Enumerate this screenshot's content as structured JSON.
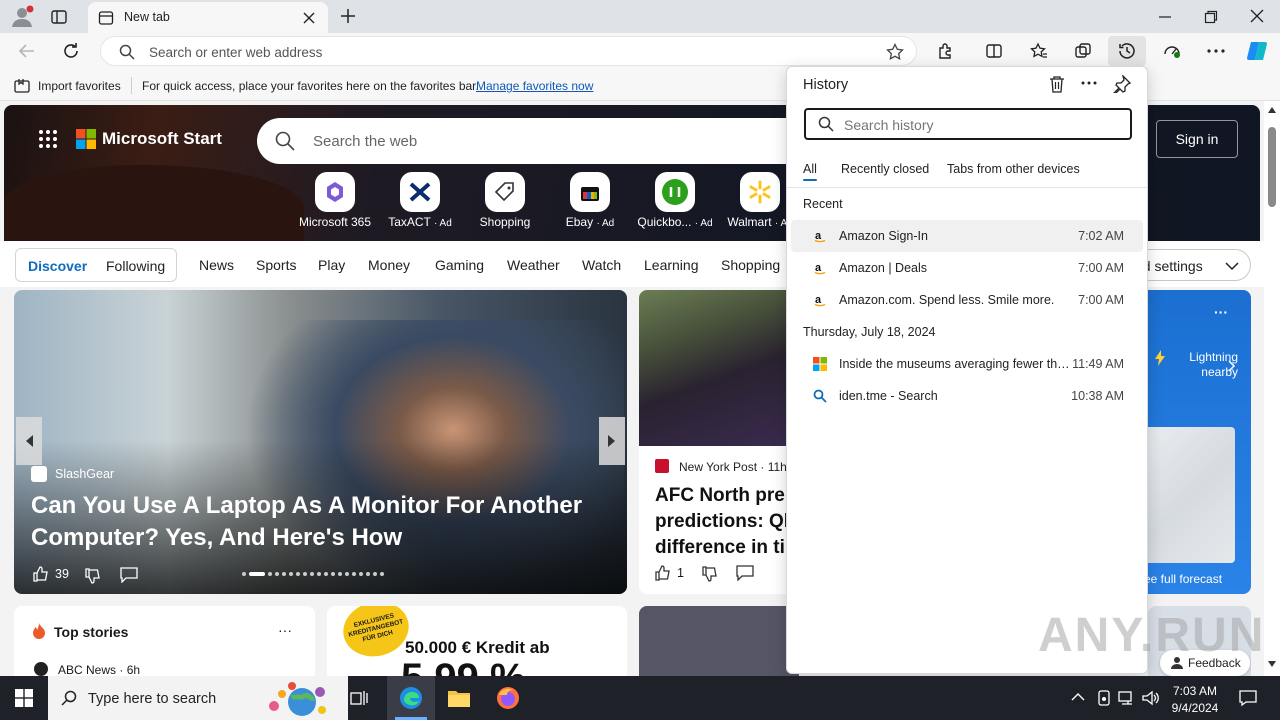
{
  "browser": {
    "tab_title": "New tab",
    "address_placeholder": "Search or enter web address"
  },
  "favorites_bar": {
    "import_label": "Import favorites",
    "hint": "For quick access, place your favorites here on the favorites bar.",
    "manage_link": "Manage favorites now"
  },
  "msstart": {
    "brand": "Microsoft Start",
    "search_placeholder": "Search the web",
    "sign_in": "Sign in",
    "tiles": [
      {
        "label": "Microsoft 365",
        "ad": ""
      },
      {
        "label": "TaxACT",
        "ad": "· Ad"
      },
      {
        "label": "Shopping",
        "ad": ""
      },
      {
        "label": "Ebay",
        "ad": "· Ad"
      },
      {
        "label": "Quickbo...",
        "ad": "· Ad"
      },
      {
        "label": "Walmart",
        "ad": "· Ad"
      }
    ],
    "nav": [
      "Discover",
      "Following",
      "News",
      "Sports",
      "Play",
      "Money",
      "Gaming",
      "Weather",
      "Watch",
      "Learning",
      "Shopping"
    ],
    "feed_settings": "ed settings",
    "main_story": {
      "source": "SlashGear",
      "headline": "Can You Use A Laptop As A Monitor For Another Computer? Yes, And Here's How",
      "likes": "39"
    },
    "second_story": {
      "source": "New York Post",
      "age": "· 11h",
      "headline": "AFC North pre predictions: Ql difference in ti",
      "likes": "1"
    },
    "weather": {
      "alert": "Lightning nearby",
      "forecast": "ee full forecast",
      "more": "···"
    },
    "top_stories": {
      "title": "Top stories",
      "more": "···",
      "first_source": "ABC News",
      "first_age": "· 6h"
    },
    "ad_card": {
      "badge": "EXKLUSIVES KREDITANGEBOT FÜR DICH",
      "headline": "50.000 € Kredit ab",
      "big": "5,99 %"
    },
    "feedback": "Feedback"
  },
  "history": {
    "title": "History",
    "search_placeholder": "Search history",
    "tabs": [
      "All",
      "Recently closed",
      "Tabs from other devices"
    ],
    "sections": [
      {
        "label": "Recent",
        "items": [
          {
            "title": "Amazon Sign-In",
            "time": "7:02 AM",
            "icon": "amazon-icon"
          },
          {
            "title": "Amazon | Deals",
            "time": "7:00 AM",
            "icon": "amazon-icon"
          },
          {
            "title": "Amazon.com. Spend less. Smile more.",
            "time": "7:00 AM",
            "icon": "amazon-icon"
          }
        ]
      },
      {
        "label": "Thursday, July 18, 2024",
        "items": [
          {
            "title": "Inside the museums averaging fewer than ...",
            "time": "11:49 AM",
            "icon": "microsoft-icon"
          },
          {
            "title": "iden.tme - Search",
            "time": "10:38 AM",
            "icon": "search-icon"
          }
        ]
      }
    ]
  },
  "taskbar": {
    "search_placeholder": "Type here to search",
    "time": "7:03 AM",
    "date": "9/4/2024"
  },
  "watermark": "ANY.RUN",
  "colors": {
    "accent": "#0f6cbd",
    "taskbar": "#1f2129"
  }
}
